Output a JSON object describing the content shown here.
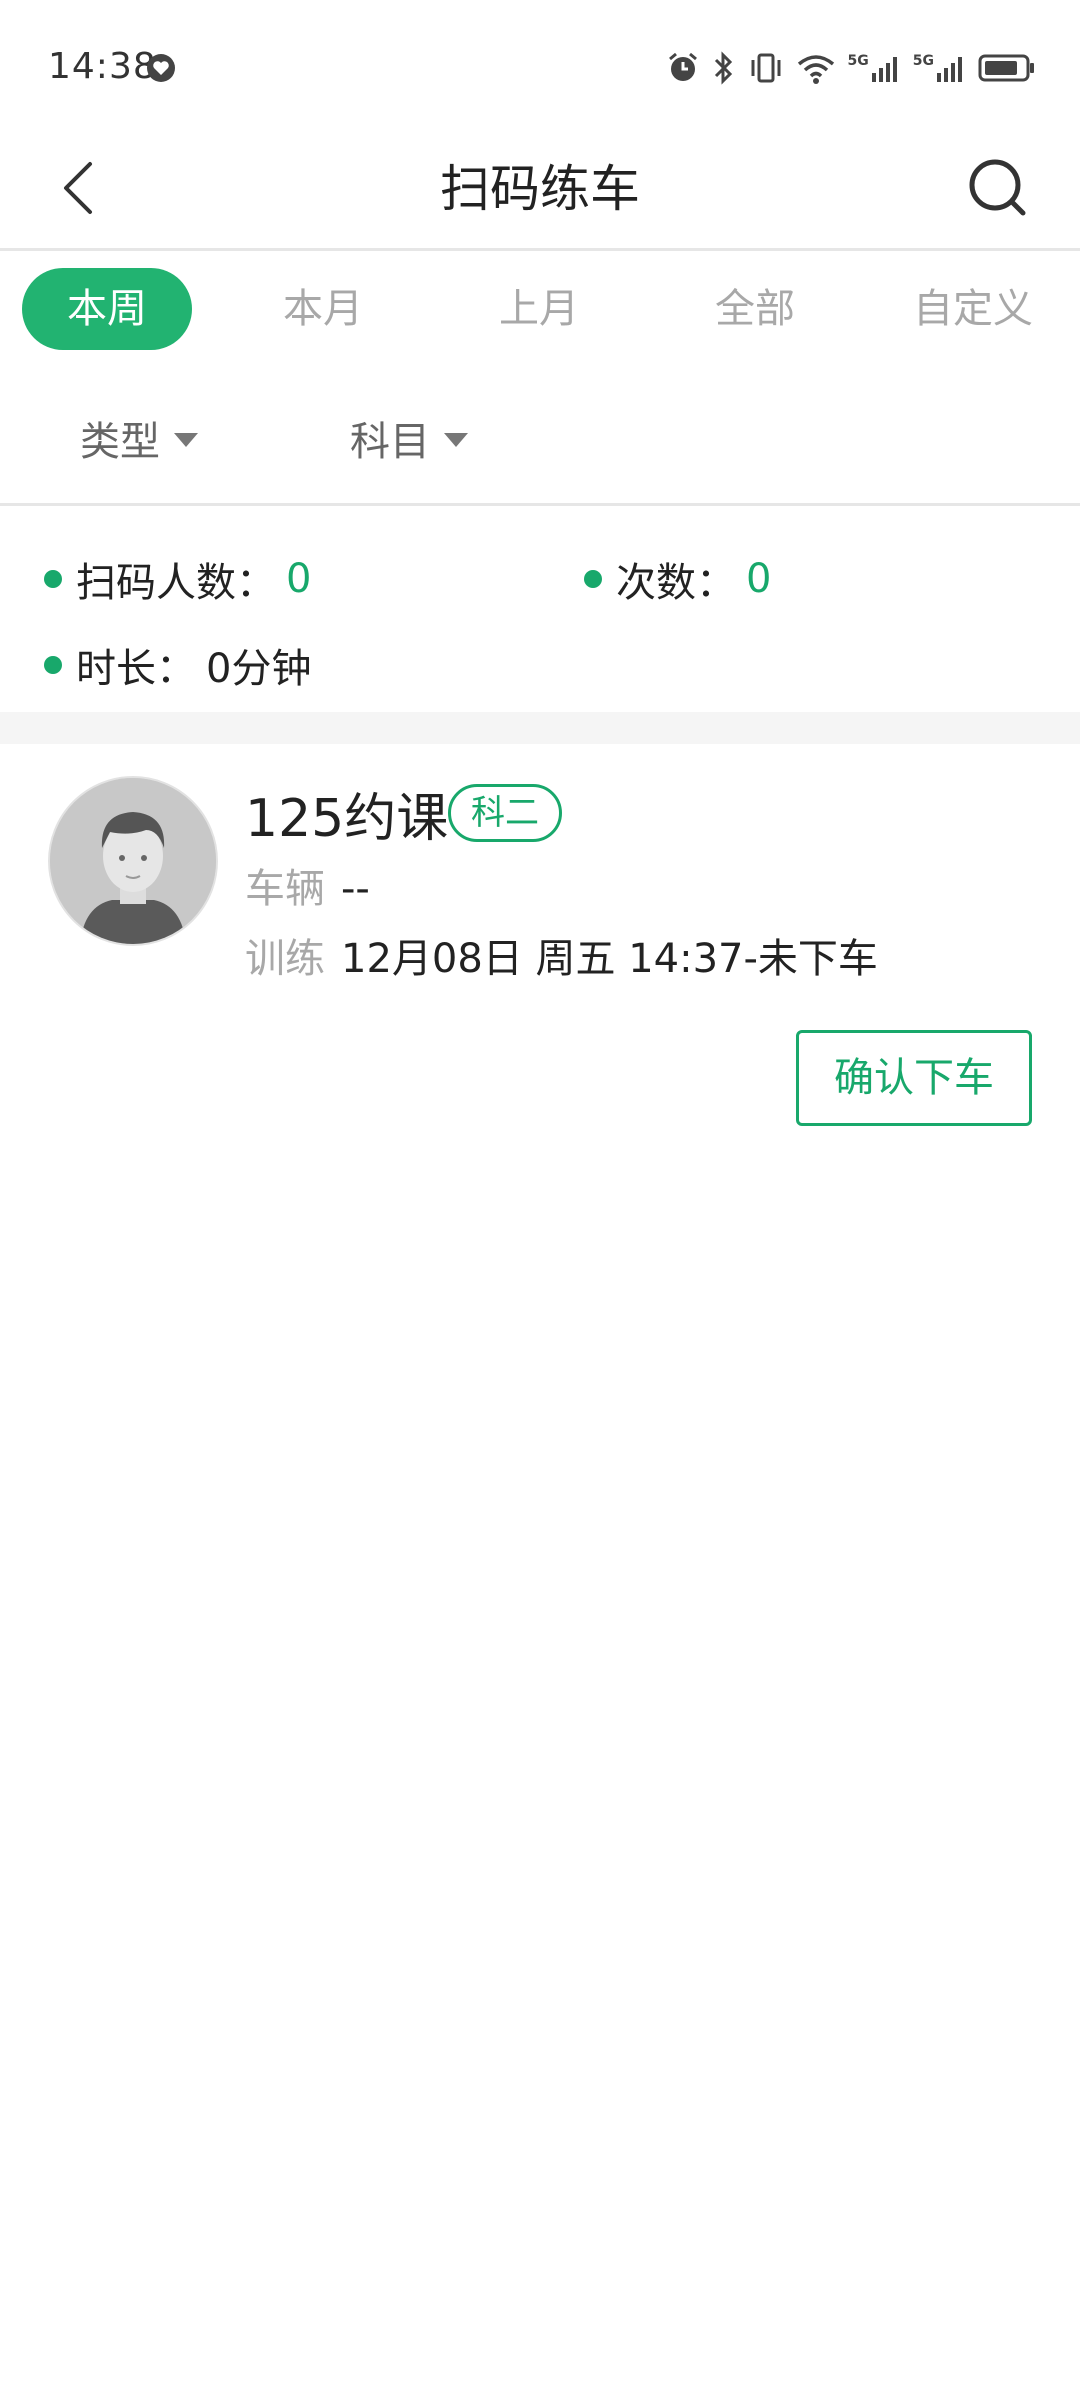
{
  "status_bar": {
    "time": "14:38",
    "icons": [
      "heart-icon",
      "alarm-icon",
      "bluetooth-icon",
      "vibrate-icon",
      "wifi-icon",
      "signal-5g-icon",
      "signal-5g-icon",
      "battery-icon"
    ],
    "signal_label_1": "5G",
    "signal_label_2": "5G"
  },
  "header": {
    "title": "扫码练车",
    "back_icon": "chevron-left-icon",
    "search_icon": "search-icon"
  },
  "tabs": [
    {
      "label": "本周",
      "active": true
    },
    {
      "label": "本月",
      "active": false
    },
    {
      "label": "上月",
      "active": false
    },
    {
      "label": "全部",
      "active": false
    },
    {
      "label": "自定义",
      "active": false
    }
  ],
  "filters": {
    "type_label": "类型",
    "subject_label": "科目"
  },
  "stats": {
    "scan_people_label": "扫码人数：",
    "scan_people_value": "0",
    "count_label": "次数：",
    "count_value": "0",
    "duration_label": "时长：",
    "duration_value": "0分钟"
  },
  "records": [
    {
      "name": "125约课",
      "tag": "科二",
      "vehicle_label": "车辆",
      "vehicle_value": "--",
      "training_label": "训练",
      "training_value": "12月08日 周五 14:37-未下车",
      "action_label": "确认下车"
    }
  ],
  "colors": {
    "accent": "#22b371",
    "accent_text": "#18a86b",
    "muted": "#a8a8a8",
    "divider": "#e6e6e6"
  }
}
